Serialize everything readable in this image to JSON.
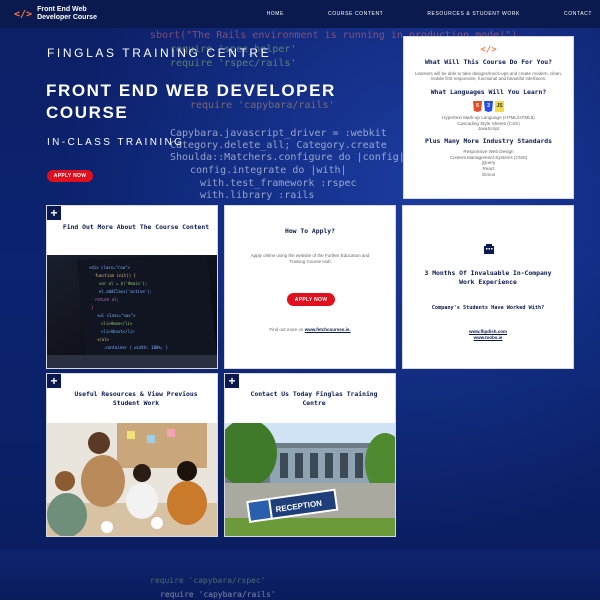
{
  "header": {
    "logo_icon": "</>",
    "logo_text": "Front End Web Developer Course",
    "nav": [
      "HOME",
      "COURSE CONTENT",
      "RESOURCES & STUDENT WORK",
      "CONTACT"
    ]
  },
  "hero": {
    "subtitle": "FINGLAS TRAINING CENTRE",
    "title": "FRONT END WEB DEVELOPER COURSE",
    "tagline": "IN-CLASS TRAINING",
    "button": "APPLY NOW"
  },
  "info_card": {
    "icon": "code-icon",
    "heading1": "What Will This Course Do For You?",
    "text1": "Learners will be able to take designs/mock-ups and create modern, clean, mobile first responsive, functional and beautiful interfaces.",
    "heading2": "What Languages Will You Learn?",
    "languages": [
      "Hypertext Mark-up Language (HTML/HTML5)",
      "Cascading Style Sheets (CSS)",
      "JavaScript"
    ],
    "heading3": "Plus Many More Industry Standards",
    "standards": [
      "Responsive Web Design",
      "Content Management Systems (CMS)",
      "jQuery",
      "React",
      "Gimus"
    ]
  },
  "cards": {
    "find_out": {
      "title": "Find Out More About The Course Content"
    },
    "apply": {
      "title": "How To Apply?",
      "text": "Apply online using the website of the Further Education and Training Course Hub",
      "button": "APPLY NOW",
      "find_text": "Find out more on",
      "link": "www.fetchcourses.ie."
    },
    "company": {
      "icon": "building-icon",
      "title": "3 Months Of Invaluable In-Company Work Experience",
      "subtitle": "Company's Students Have Worked With?",
      "links": [
        "www.flipdish.com",
        "www.toobs.ie"
      ]
    },
    "resources": {
      "title": "Useful Resources & View Previous Student Work"
    },
    "contact": {
      "title": "Contact Us Today Finglas Training Centre",
      "sign": "RECEPTION"
    }
  },
  "colors": {
    "navy": "#0a1a4e",
    "accent_red": "#e0101f",
    "accent_orange": "#ff7a3c"
  }
}
